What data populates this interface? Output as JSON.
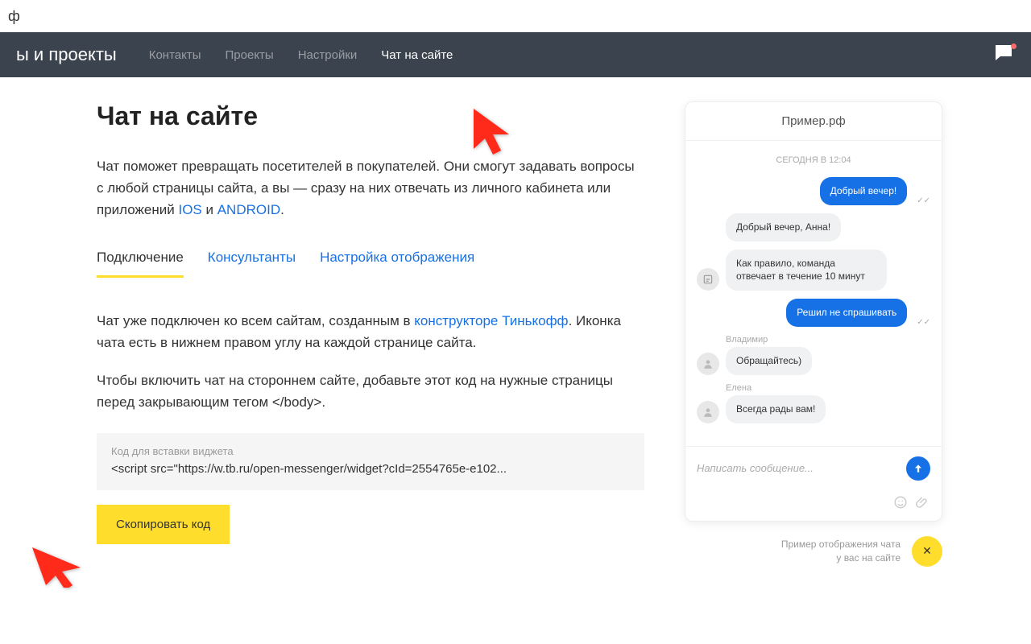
{
  "top_bar": {
    "text": "ф"
  },
  "nav": {
    "title": "ы и проекты",
    "items": [
      "Контакты",
      "Проекты",
      "Настройки",
      "Чат на сайте"
    ],
    "active_index": 3
  },
  "page": {
    "title": "Чат на сайте",
    "intro_before": "Чат поможет превращать посетителей в покупателей. Они смогут задавать вопросы с любой страницы сайта, а вы — сразу на них отвечать из личного кабинета или приложений ",
    "intro_link1": "IOS",
    "intro_mid": " и ",
    "intro_link2": "ANDROID",
    "intro_after": "."
  },
  "tabs": {
    "items": [
      "Подключение",
      "Консультанты",
      "Настройка отображения"
    ],
    "active_index": 0
  },
  "content": {
    "p1_before": "Чат уже подключен ко всем сайтам, созданным в ",
    "p1_link": "конструкторе Тинькофф",
    "p1_after": ". Иконка чата есть в нижнем правом углу на каждой странице сайта.",
    "p2": "Чтобы включить чат на стороннем сайте, добавьте этот код на нужные страницы перед закрывающим тегом </body>."
  },
  "code_box": {
    "label": "Код для вставки виджета",
    "code": "<script src=\"https://w.tb.ru/open-messenger/widget?cId=2554765e-e102..."
  },
  "copy_button": "Скопировать код",
  "chat_preview": {
    "header": "Пример.рф",
    "date": "СЕГОДНЯ В 12:04",
    "messages": [
      {
        "side": "right",
        "bubble_class": "blue",
        "text": "Добрый вечер!",
        "ticks": true
      },
      {
        "side": "left",
        "bubble_class": "gray",
        "text": "Добрый вечер, Анна!"
      },
      {
        "side": "left",
        "bubble_class": "gray",
        "text": "Как правило, команда отвечает в течение 10 минут",
        "avatar": true
      },
      {
        "side": "right",
        "bubble_class": "blue",
        "text": "Решил не спрашивать",
        "ticks": true
      },
      {
        "side": "left",
        "name": "Владимир",
        "bubble_class": "gray",
        "text": "Обращайтесь)",
        "avatar": true
      },
      {
        "side": "left",
        "name": "Елена",
        "bubble_class": "gray",
        "text": "Всегда рады вам!",
        "avatar": true
      }
    ],
    "input_placeholder": "Написать сообщение...",
    "caption_line1": "Пример отображения чата",
    "caption_line2": "у вас на сайте",
    "close_symbol": "✕"
  }
}
